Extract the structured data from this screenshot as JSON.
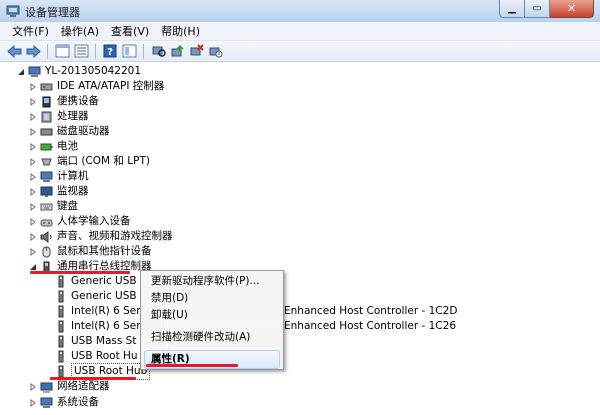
{
  "window": {
    "title": "设备管理器"
  },
  "menu": [
    "文件(F)",
    "操作(A)",
    "查看(V)",
    "帮助(H)"
  ],
  "toolbar": [
    "back-icon",
    "forward-icon",
    "properties-view-icon",
    "list-view-icon",
    "help-icon",
    "details-icon",
    "scan-hardware-icon",
    "update-driver-icon",
    "uninstall-icon",
    "disable-icon"
  ],
  "tree": {
    "root": "YL-201305042201",
    "categories": [
      "IDE ATA/ATAPI 控制器",
      "便携设备",
      "处理器",
      "磁盘驱动器",
      "电池",
      "端口 (COM 和 LPT)",
      "计算机",
      "监视器",
      "键盘",
      "人体学输入设备",
      "声音、视频和游戏控制器",
      "鼠标和其他指针设备",
      "通用串行总线控制器"
    ],
    "usb_children": [
      "Generic USB",
      "Generic USB",
      "Intel(R) 6 Ser",
      "Intel(R) 6 Ser",
      "USB Mass St",
      "USB Root Hu",
      "USB Root Hub"
    ],
    "obscured_tails": [
      "Enhanced Host Controller - 1C2D",
      "Enhanced Host Controller - 1C26"
    ],
    "after": [
      "网络适配器",
      "系统设备"
    ]
  },
  "context_menu": {
    "items": [
      "更新驱动程序软件(P)...",
      "禁用(D)",
      "卸载(U)",
      "扫描检测硬件改动(A)",
      "属性(R)"
    ]
  },
  "colors": {
    "accent_red": "#e8192c",
    "titlebar": "#c9dcf2",
    "selection_border": "#aecff7"
  }
}
